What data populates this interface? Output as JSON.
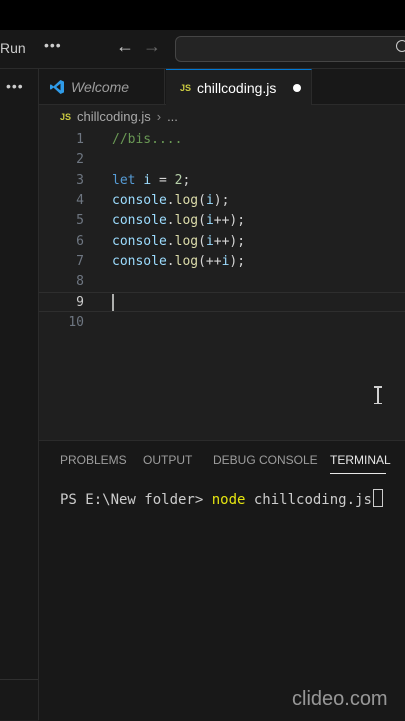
{
  "titlebar": {
    "menu_run": "Run",
    "more": "•••",
    "back": "←",
    "forward": "→"
  },
  "sidebar": {
    "more": "•••"
  },
  "tabs": [
    {
      "label": "Welcome",
      "icon": "vscode-icon",
      "active": false
    },
    {
      "label": "chillcoding.js",
      "icon": "js-icon",
      "active": true,
      "dirty": true
    }
  ],
  "breadcrumb": {
    "icon_text": "JS",
    "file": "chillcoding.js",
    "sep": "›",
    "more": "..."
  },
  "editor": {
    "lines": [
      {
        "n": "1",
        "tokens": [
          {
            "t": "//bis....",
            "c": "comment"
          }
        ]
      },
      {
        "n": "2",
        "tokens": []
      },
      {
        "n": "3",
        "tokens": [
          {
            "t": "let",
            "c": "kw"
          },
          {
            "t": " ",
            "c": ""
          },
          {
            "t": "i",
            "c": "var"
          },
          {
            "t": " = ",
            "c": ""
          },
          {
            "t": "2",
            "c": "num"
          },
          {
            "t": ";",
            "c": ""
          }
        ]
      },
      {
        "n": "4",
        "tokens": [
          {
            "t": "console",
            "c": "var"
          },
          {
            "t": ".",
            "c": ""
          },
          {
            "t": "log",
            "c": "fn"
          },
          {
            "t": "(",
            "c": ""
          },
          {
            "t": "i",
            "c": "var"
          },
          {
            "t": ");",
            "c": ""
          }
        ]
      },
      {
        "n": "5",
        "tokens": [
          {
            "t": "console",
            "c": "var"
          },
          {
            "t": ".",
            "c": ""
          },
          {
            "t": "log",
            "c": "fn"
          },
          {
            "t": "(",
            "c": ""
          },
          {
            "t": "i",
            "c": "var"
          },
          {
            "t": "++);",
            "c": ""
          }
        ]
      },
      {
        "n": "6",
        "tokens": [
          {
            "t": "console",
            "c": "var"
          },
          {
            "t": ".",
            "c": ""
          },
          {
            "t": "log",
            "c": "fn"
          },
          {
            "t": "(",
            "c": ""
          },
          {
            "t": "i",
            "c": "var"
          },
          {
            "t": "++);",
            "c": ""
          }
        ]
      },
      {
        "n": "7",
        "tokens": [
          {
            "t": "console",
            "c": "var"
          },
          {
            "t": ".",
            "c": ""
          },
          {
            "t": "log",
            "c": "fn"
          },
          {
            "t": "(++",
            "c": ""
          },
          {
            "t": "i",
            "c": "var"
          },
          {
            "t": ");",
            "c": ""
          }
        ]
      },
      {
        "n": "8",
        "tokens": []
      },
      {
        "n": "9",
        "tokens": [],
        "current": true
      },
      {
        "n": "10",
        "tokens": []
      }
    ]
  },
  "panel": {
    "tabs": [
      "PROBLEMS",
      "OUTPUT",
      "DEBUG CONSOLE",
      "TERMINAL"
    ],
    "active_tab": "TERMINAL",
    "terminal": {
      "prompt": "PS E:\\New folder> ",
      "command": "node",
      "args": " chillcoding.js"
    }
  },
  "watermark": "clideo.com",
  "colors": {
    "accent": "#0078d4",
    "comment": "#6a9955",
    "keyword": "#569cd6",
    "variable": "#9cdcfe",
    "number": "#b5cea8",
    "function": "#dcdcaa",
    "terminal_cmd": "#e5e510"
  }
}
